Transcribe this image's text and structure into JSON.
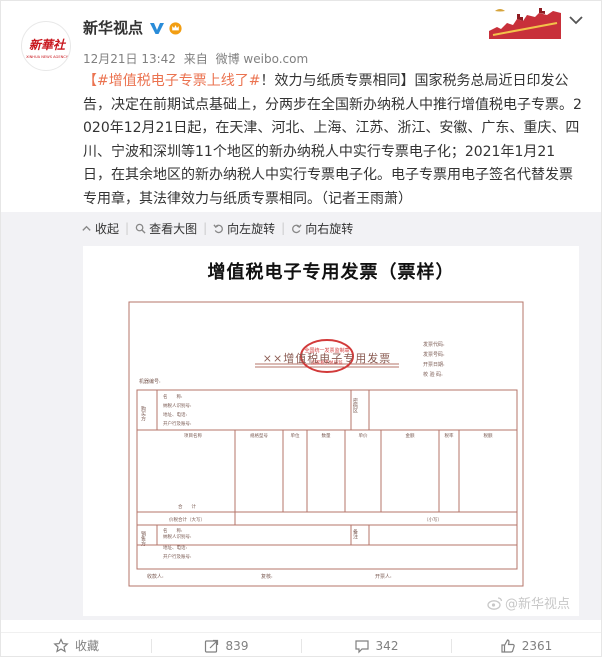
{
  "author": {
    "name": "新华视点",
    "avatar_text": "新華社",
    "avatar_subtext": "XINHUA NEWS AGENCY"
  },
  "meta": {
    "date": "12月21日 13:42",
    "from_label": "来自",
    "source": "微博 weibo.com"
  },
  "post": {
    "bracket_open": "【",
    "hashtag": "#增值税电子专票上线了#",
    "headline_rest": "！效力与纸质专票相同】",
    "body": "国家税务总局近日印发公告，决定在前期试点基础上，分两步在全国新办纳税人中推行增值税电子专票。2020年12月21日起，在天津、河北、上海、江苏、浙江、安徽、广东、重庆、四川、宁波和深圳等11个地区的新办纳税人中实行专票电子化；2021年1月21日，在其余地区的新办纳税人中实行专票电子化。电子专票用电子签名代替发票专用章，其法律效力与纸质专票相同。（记者王雨萧）"
  },
  "media_toolbar": {
    "collapse": "收起",
    "view_large": "查看大图",
    "rotate_left": "向左旋转",
    "rotate_right": "向右旋转"
  },
  "invoice": {
    "title": "增值税电子专用发票（票样）",
    "form_title": "××增值税电子专用发票",
    "stamp_top": "全国统一发票监制章",
    "stamp_bottom": "国家税务总局监",
    "right_labels": [
      "发票代码:",
      "发票号码:",
      "开票日期:",
      "校 验 码:"
    ],
    "machine_no": "机器编号:",
    "buyer_side": "购买方",
    "buyer_fields": [
      "名　　称:",
      "纳税人识别号:",
      "地址、电话:",
      "开户行及账号:"
    ],
    "password_area": "密码区",
    "columns": [
      "项目名称",
      "规格型号",
      "单位",
      "数量",
      "单价",
      "金额",
      "税率",
      "税额"
    ],
    "total": "合　　计",
    "tax_total_label": "价税合计（大写）",
    "tax_total_small": "（小写）",
    "seller_side": "销售方",
    "seller_fields": [
      "名　　称:",
      "纳税人识别号:",
      "地址、电话:",
      "开户行及账号:"
    ],
    "remarks": "备注",
    "bottom_labels": [
      "收款人:",
      "复核:",
      "开票人:"
    ]
  },
  "watermark": "@新华视点",
  "footer": {
    "favorite": "收藏",
    "forward_count": "839",
    "comment_count": "342",
    "like_count": "2361"
  },
  "colors": {
    "link": "#eb7350",
    "invoice_line": "#b5746a",
    "stamp": "#d23a3a",
    "verified": "#2a8cd8",
    "member": "#f29e12"
  }
}
